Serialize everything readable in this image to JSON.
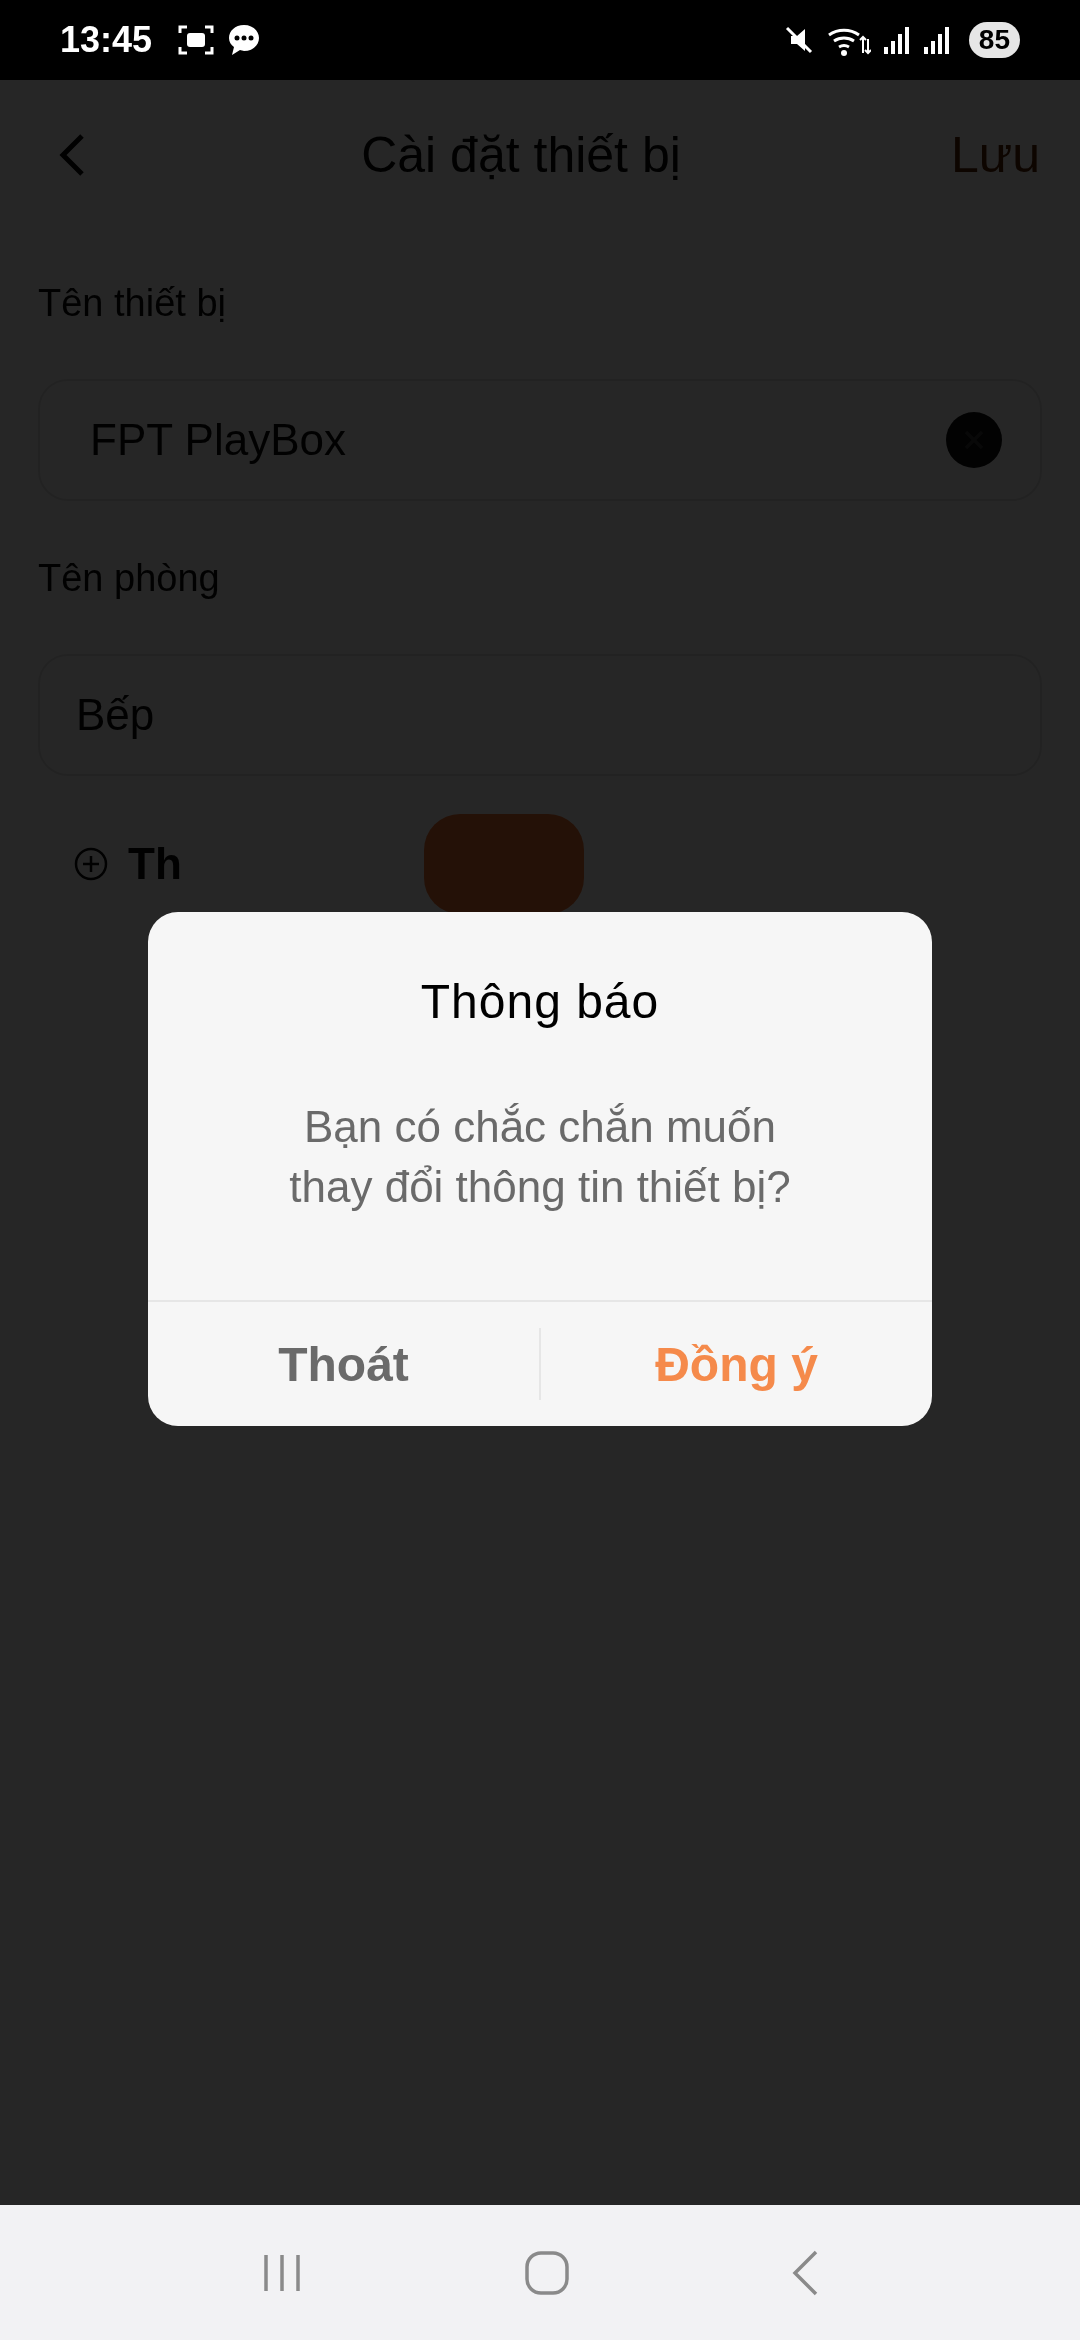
{
  "status_bar": {
    "time": "13:45",
    "battery": "85"
  },
  "header": {
    "title": "Cài đặt thiết bị",
    "action": "Lưu"
  },
  "fields": [
    {
      "label": "Tên thiết bị",
      "value": "FPT PlayBox",
      "clear_button": true
    },
    {
      "label": "Tên phòng",
      "value": "Bếp",
      "clear_button": false
    }
  ],
  "add_row": {
    "label": "Th"
  },
  "dialog": {
    "title": "Thông báo",
    "message": "Bạn có chắc chắn muốn thay đổi thông tin thiết bị?",
    "buttons": [
      {
        "label": "Thoát",
        "kind": "cancel"
      },
      {
        "label": "Đồng ý",
        "kind": "confirm"
      }
    ]
  }
}
